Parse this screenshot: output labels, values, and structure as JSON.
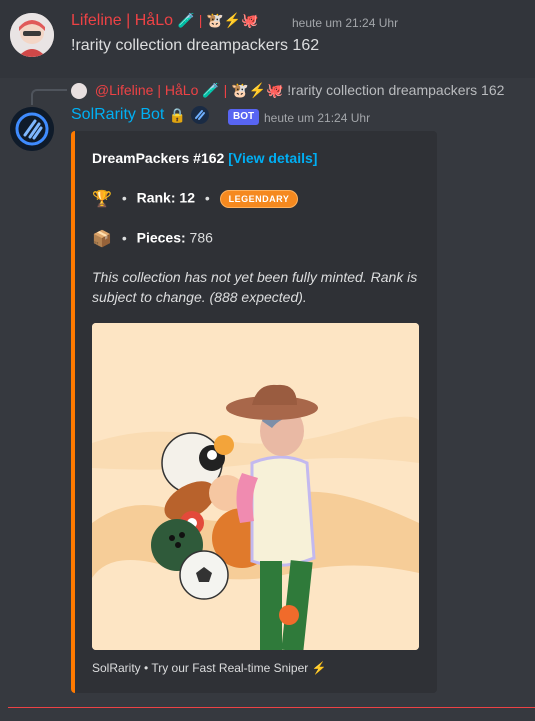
{
  "message1": {
    "username": "Lifeline | HåLo",
    "username_suffix": "🧪 | 🐮⚡🐙",
    "timestamp": "heute um 21:24 Uhr",
    "text": "!rarity collection dreampackers 162"
  },
  "reply": {
    "mention": "@Lifeline | HåLo",
    "mention_suffix": "🧪 | 🐮⚡🐙",
    "text": "!rarity collection dreampackers 162"
  },
  "message2": {
    "username": "SolRarity Bot",
    "badge": "BOT",
    "timestamp": "heute um 21:24 Uhr",
    "embed": {
      "accent_color": "#ff7a00",
      "title": "DreamPackers #162",
      "link_text": "[View details]",
      "rank_label": "Rank:",
      "rank_value": "12",
      "rarity_badge": "LEGENDARY",
      "pieces_label": "Pieces:",
      "pieces_value": "786",
      "description": "This collection has not yet been fully minted. Rank is subject to change. (888 expected).",
      "footer": "SolRarity • Try our Fast Real-time Sniper ⚡"
    }
  }
}
